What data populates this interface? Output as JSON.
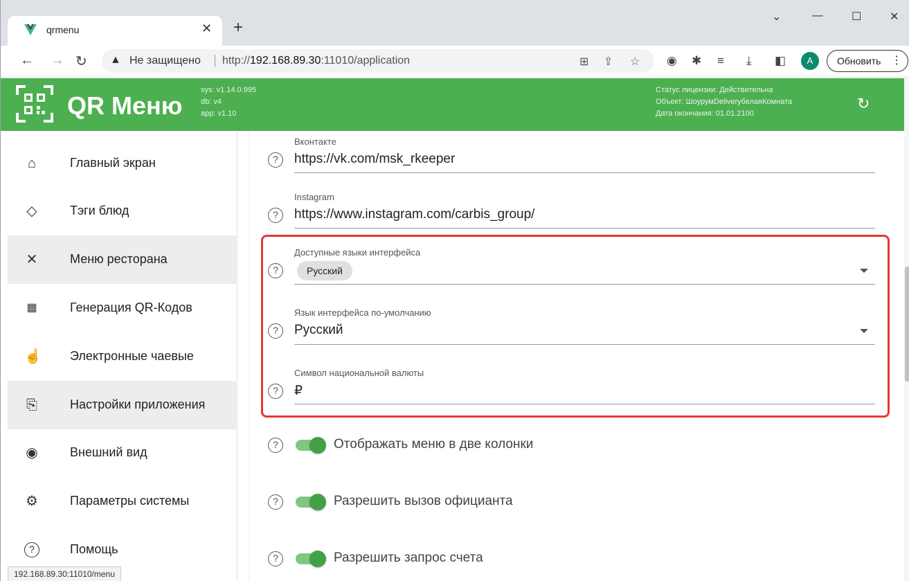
{
  "browser": {
    "tab_title": "qrmenu",
    "tab_close": "✕",
    "new_tab": "+",
    "not_secure": "Не защищено",
    "url_prefix": "http://",
    "url_host": "192.168.89.30",
    "url_rest": ":11010/application",
    "avatar": "A",
    "update_label": "Обновить",
    "status_url": "192.168.89.30:11010/menu"
  },
  "header": {
    "app_name": "QR Меню",
    "versions": [
      "sys: v1.14.0.995",
      "db: v4",
      "app: v1.10"
    ],
    "license": [
      "Статус лицензии: Действительна",
      "Объект: ШоурумDeliveryбелаяКомната",
      "Дата окончания: 01.01.2100"
    ]
  },
  "sidebar": {
    "items": [
      {
        "label": "Главный экран",
        "icon": "home-icon",
        "active": false
      },
      {
        "label": "Тэги блюд",
        "icon": "tag-icon",
        "active": false
      },
      {
        "label": "Меню ресторана",
        "icon": "cutlery-icon",
        "active": true
      },
      {
        "label": "Генерация QR-Кодов",
        "icon": "qr-icon",
        "active": false
      },
      {
        "label": "Электронные чаевые",
        "icon": "tips-icon",
        "active": false
      },
      {
        "label": "Настройки приложения",
        "icon": "app-settings-icon",
        "active": true
      },
      {
        "label": "Внешний вид",
        "icon": "eye-icon",
        "active": false
      },
      {
        "label": "Параметры системы",
        "icon": "gear-icon",
        "active": false
      },
      {
        "label": "Помощь",
        "icon": "help-icon",
        "active": false
      }
    ]
  },
  "form": {
    "vk": {
      "label": "Вконтакте",
      "value": "https://vk.com/msk_rkeeper"
    },
    "instagram": {
      "label": "Instagram",
      "value": "https://www.instagram.com/carbis_group/"
    },
    "languages": {
      "label": "Доступные языки интерфейса",
      "chip": "Русский"
    },
    "default_language": {
      "label": "Язык интерфейса по-умолчанию",
      "value": "Русский"
    },
    "currency": {
      "label": "Символ национальной валюты",
      "value": "₽"
    },
    "two_columns": {
      "label": "Отображать меню в две колонки",
      "on": true
    },
    "call_waiter": {
      "label": "Разрешить вызов официанта",
      "on": true
    },
    "request_bill": {
      "label": "Разрешить запрос счета",
      "on": true
    }
  },
  "colors": {
    "brand": "#4caf50",
    "highlight": "#e53935",
    "switch": "#43a047"
  }
}
